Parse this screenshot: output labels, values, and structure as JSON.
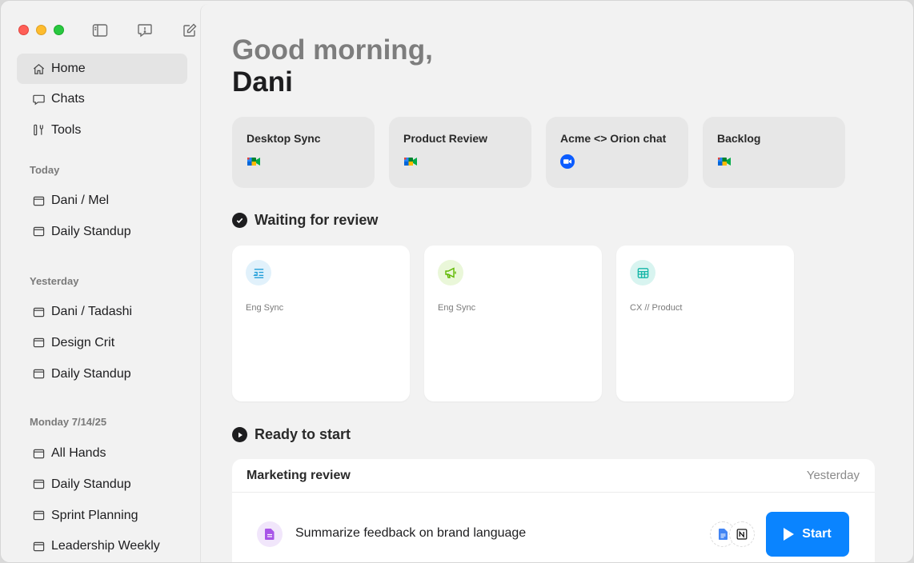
{
  "sidebar": {
    "nav": [
      {
        "label": "Home",
        "icon": "home-icon",
        "active": true
      },
      {
        "label": "Chats",
        "icon": "chat-icon"
      },
      {
        "label": "Tools",
        "icon": "tools-icon"
      }
    ],
    "sections": [
      {
        "label": "Today",
        "items": [
          "Dani / Mel",
          "Daily Standup"
        ]
      },
      {
        "label": "Yesterday",
        "items": [
          "Dani / Tadashi",
          "Design Crit",
          "Daily Standup"
        ]
      },
      {
        "label": "Monday 7/14/25",
        "items": [
          "All Hands",
          "Daily Standup",
          "Sprint Planning",
          "Leadership Weekly"
        ]
      }
    ]
  },
  "main": {
    "greeting_line1": "Good morning,",
    "greeting_line2": "Dani",
    "meetings": [
      {
        "title": "Desktop Sync",
        "app": "google-meet-icon"
      },
      {
        "title": "Product Review",
        "app": "google-meet-icon"
      },
      {
        "title": "Acme <> Orion chat",
        "app": "zoom-icon"
      },
      {
        "title": "Backlog",
        "app": "google-meet-icon"
      }
    ],
    "waiting_title": "Waiting for review",
    "review_cards": [
      {
        "label": "Eng Sync",
        "icon": "list-icon",
        "color": "#1a9bd7"
      },
      {
        "label": "Eng Sync",
        "icon": "megaphone-icon",
        "color": "#5fb800"
      },
      {
        "label": "CX // Product",
        "icon": "table-icon",
        "color": "#13b5a6"
      }
    ],
    "ready_title": "Ready to start",
    "task_panel": {
      "title": "Marketing review",
      "date": "Yesterday",
      "task": "Summarize feedback on brand language",
      "start_label": "Start"
    }
  },
  "colors": {
    "accent": "#0a84ff",
    "traffic_red": "#ff5f57",
    "traffic_yellow": "#febc2e",
    "traffic_green": "#28c840"
  }
}
